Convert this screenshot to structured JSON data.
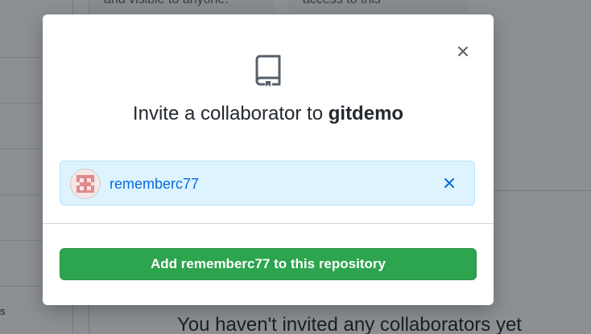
{
  "background": {
    "card_left_text": "and visible to anyone.",
    "card_right_text": "access to this",
    "sidebar_peek_text": "s",
    "empty_state_text": "You haven't invited any collaborators yet"
  },
  "modal": {
    "title_prefix": "Invite a collaborator to",
    "repo_name": "gitdemo",
    "selected_user": {
      "username": "rememberc77"
    },
    "add_button_label": "Add rememberc77 to this repository",
    "icons": {
      "repo": "repo-icon",
      "close": "close-icon",
      "remove": "remove-icon"
    }
  },
  "colors": {
    "primary_button": "#2da44e",
    "link": "#0969da",
    "chip_background": "#ddf4ff"
  }
}
